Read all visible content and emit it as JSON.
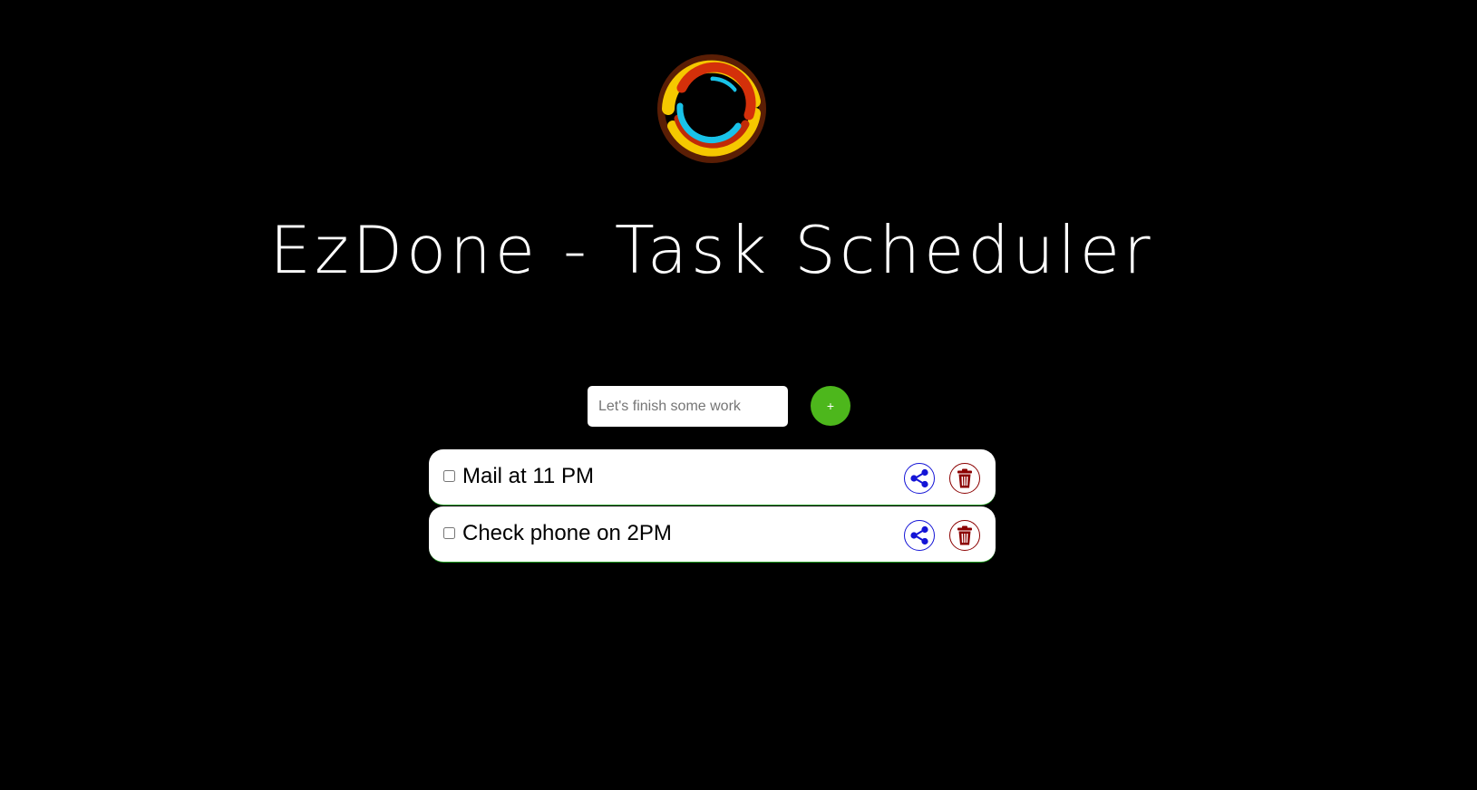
{
  "app": {
    "logo_icon": "ring-logo-icon",
    "title": "EzDone - Task Scheduler"
  },
  "input": {
    "placeholder": "Let's finish some work",
    "value": ""
  },
  "add_button": {
    "label": "+",
    "color": "#4db71c"
  },
  "tasks": [
    {
      "text": "Mail at 11 PM",
      "checked": false,
      "share_icon": "share-icon",
      "delete_icon": "trash-icon"
    },
    {
      "text": "Check phone on 2PM",
      "checked": false,
      "share_icon": "share-icon",
      "delete_icon": "trash-icon"
    }
  ],
  "colors": {
    "background": "#000000",
    "share": "#1414d6",
    "delete": "#8b0000",
    "row_border": "#1f9e1f"
  }
}
